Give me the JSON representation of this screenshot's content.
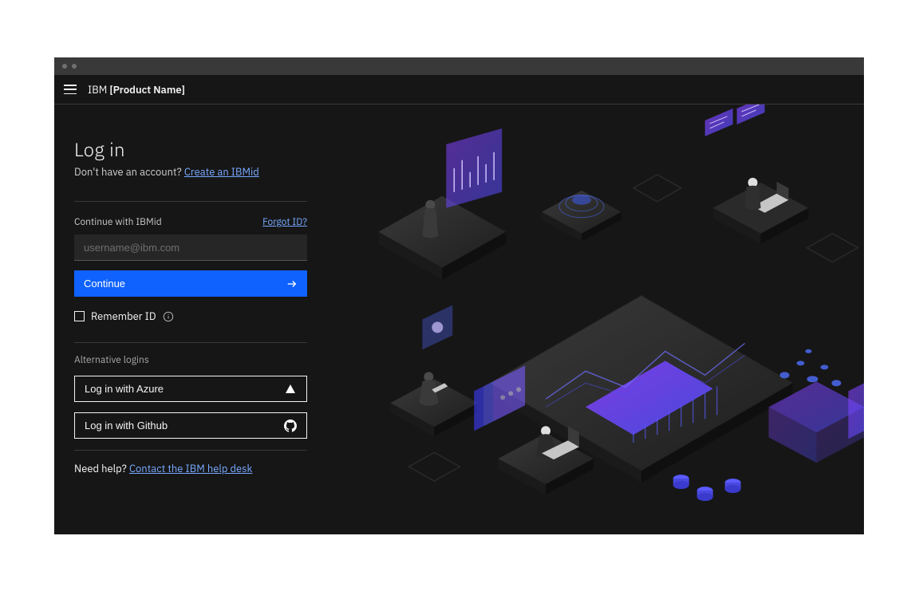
{
  "header": {
    "brand_prefix": "IBM",
    "brand_name": "[Product Name]"
  },
  "login": {
    "title": "Log in",
    "account_prompt": "Don't have an account?",
    "create_link": "Create an IBMid",
    "ibmid_label": "Continue with IBMid",
    "forgot": "Forgot ID?",
    "username_placeholder": "username@ibm.com",
    "continue_btn": "Continue",
    "remember_label": "Remember ID",
    "alt_heading": "Alternative logins",
    "providers": [
      {
        "label": "Log in with Azure"
      },
      {
        "label": "Log in with Github"
      }
    ],
    "help_prompt": "Need help?",
    "help_link": "Contact the IBM help desk"
  },
  "colors": {
    "accent": "#0f62fe",
    "link": "#78a9ff",
    "bg": "#161616",
    "input_bg": "#262626"
  }
}
